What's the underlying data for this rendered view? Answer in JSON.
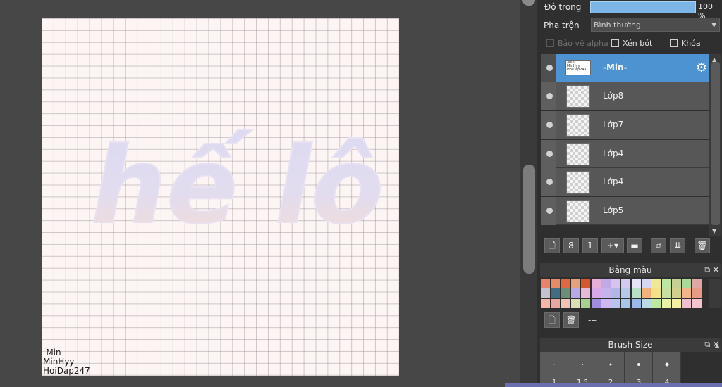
{
  "canvas": {
    "art_text": "hế lô",
    "watermark": [
      "-Min-",
      "MinHyy",
      "HoiDap247"
    ]
  },
  "layer_properties": {
    "opacity_label": "Độ trong",
    "opacity_value": "100 %",
    "opacity_percent": 100,
    "blend_label": "Pha trộn",
    "blend_value": "Bình thường",
    "protect_alpha_label": "Bảo vệ alpha",
    "clipping_label": "Xén bớt",
    "lock_label": "Khóa"
  },
  "layers": [
    {
      "name": "-Min-",
      "selected": true,
      "thumb_text": "-Min- MinHyy HoiDap247"
    },
    {
      "name": "Lớp8",
      "selected": false
    },
    {
      "name": "Lớp7",
      "selected": false
    },
    {
      "name": "Lớp4",
      "selected": false
    },
    {
      "name": "Lớp4",
      "selected": false
    },
    {
      "name": "Lớp5",
      "selected": false
    }
  ],
  "layer_toolbar": [
    "new-layer-icon",
    "new-8bit-layer-icon",
    "new-1bit-layer-icon",
    "add-layer-menu-icon",
    "new-folder-icon",
    "duplicate-layer-icon",
    "merge-down-icon",
    "delete-layer-icon"
  ],
  "palette": {
    "title": "Bảng màu",
    "name": "---",
    "colors": [
      [
        "#e8846a",
        "#e78b67",
        "#df6a3f",
        "#e3a17c",
        "#d8562e",
        "#e6aed9",
        "#c1a9e6",
        "#d7c3f0",
        "#d2c8f0",
        "#e7e4f7",
        "#d5d6f2",
        "#f0e895",
        "#bde6a5",
        "#c6cf95",
        "#a9d99a",
        "#dfa6a5"
      ],
      [
        "#c3c2cf",
        "#3e6d84",
        "#6b8e76",
        "#b8a9e6",
        "#e6b9d6",
        "#d8a8ea",
        "#c6b3ea",
        "#b2b6e6",
        "#b6c8e8",
        "#b8e0c8",
        "#f0b27a",
        "#f4e28b",
        "#c5e0a0",
        "#d3d08d",
        "#f2b48a",
        "#e99a86"
      ],
      [
        "#f6b7a8",
        "#e8a6a0",
        "#f1c3b6",
        "#dadfb7",
        "#a8d08f",
        "#a18de0",
        "#cdb8f2",
        "#b8c4f0",
        "#a8c6ea",
        "#9ab8ea",
        "#b9dbe4",
        "#bde8a2",
        "#e8f3a3",
        "#f4f1a5",
        "#efbfd0",
        "#f3c4cf"
      ]
    ]
  },
  "brush_size": {
    "title": "Brush Size",
    "sizes": [
      "1",
      "1.5",
      "2",
      "3",
      "4"
    ]
  },
  "colors": {
    "selected_layer": "#4e93d1",
    "opacity_bar": "#7cb6e6",
    "canvas_bg": "#fcf5f3"
  }
}
